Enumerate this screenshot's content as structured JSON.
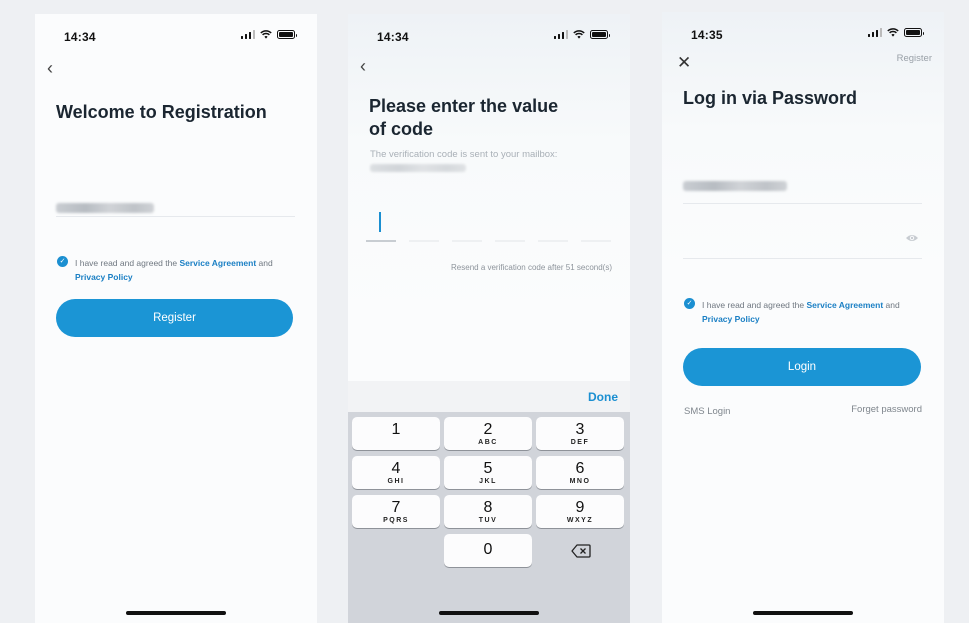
{
  "screens": [
    {
      "time": "14:34",
      "title": "Welcome to Registration",
      "agreement": {
        "prefix": "I have read and agreed the ",
        "service": "Service Agreement",
        "and": " and",
        "privacy": "Privacy Policy"
      },
      "button": "Register"
    },
    {
      "time": "14:34",
      "title_line1": "Please enter the value",
      "title_line2": "of code",
      "subtitle": "The verification code is sent to your mailbox:",
      "resend": "Resend a verification code after 51 second(s)",
      "done": "Done",
      "keys": [
        {
          "digit": "1",
          "letters": ""
        },
        {
          "digit": "2",
          "letters": "ABC"
        },
        {
          "digit": "3",
          "letters": "DEF"
        },
        {
          "digit": "4",
          "letters": "GHI"
        },
        {
          "digit": "5",
          "letters": "JKL"
        },
        {
          "digit": "6",
          "letters": "MNO"
        },
        {
          "digit": "7",
          "letters": "PQRS"
        },
        {
          "digit": "8",
          "letters": "TUV"
        },
        {
          "digit": "9",
          "letters": "WXYZ"
        },
        {
          "digit": "0",
          "letters": ""
        }
      ]
    },
    {
      "time": "14:35",
      "register_link": "Register",
      "title": "Log in via Password",
      "agreement": {
        "prefix": "I have read and agreed the ",
        "service": "Service Agreement",
        "and": " and",
        "privacy": "Privacy Policy"
      },
      "button": "Login",
      "sms_login": "SMS Login",
      "forget_password": "Forget password"
    }
  ],
  "colors": {
    "accent": "#1b95d5",
    "link": "#1a7fc4",
    "keyboard": "#d1d4da"
  },
  "icons": [
    "back-icon",
    "close-icon",
    "check-icon",
    "eye-icon",
    "delete-icon",
    "signal-icon",
    "wifi-icon",
    "battery-icon"
  ]
}
